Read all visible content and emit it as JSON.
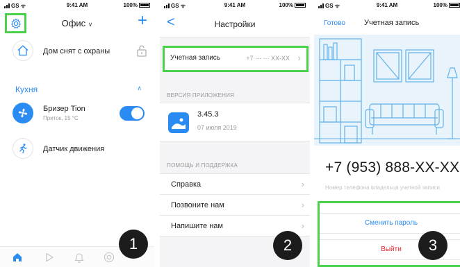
{
  "screen1": {
    "status": {
      "carrier": "GS",
      "time": "9:41 AM",
      "battery": "100%"
    },
    "title": "Офис",
    "title_chevron": "∨",
    "add_label": "+",
    "home_row": {
      "label": "Дом снят с охраны"
    },
    "section": {
      "label": "Кухня",
      "chevron": "∧"
    },
    "breezer": {
      "label": "Бризер Tion",
      "sub": "Приток, 15 °C",
      "toggle_on": true
    },
    "motion": {
      "label": "Датчик движения"
    },
    "tabs": [
      "home-icon",
      "play-icon",
      "bell-icon",
      "settings-icon"
    ],
    "step": "1"
  },
  "screen2": {
    "status": {
      "carrier": "GS",
      "time": "9:41 AM",
      "battery": "100%"
    },
    "title": "Настройки",
    "back": "<",
    "account": {
      "label": "Учетная запись",
      "value": "+7 ··· ··· XX-XX"
    },
    "app_version_header": "ВЕРСИЯ ПРИЛОЖЕНИЯ",
    "app": {
      "version": "3.45.3",
      "date": "07 июля 2019"
    },
    "help_header": "ПОМОЩЬ И ПОДДЕРЖКА",
    "help_items": [
      {
        "label": "Справка"
      },
      {
        "label": "Позвоните нам"
      },
      {
        "label": "Напишите нам"
      }
    ],
    "step": "2"
  },
  "screen3": {
    "status": {
      "carrier": "GS",
      "time": "9:41 AM",
      "battery": "100%"
    },
    "done": "Готово",
    "title": "Учетная запись",
    "phone": "+7 (953) 888-XX-XX",
    "phone_hint": "Номер телефона владельца учетной записи",
    "change_password": "Сменить пароль",
    "logout": "Выйти",
    "step": "3"
  },
  "colors": {
    "accent": "#2a8cf3",
    "highlight": "#4cd14c",
    "danger": "#e8262b",
    "badge": "#1c1c1c"
  }
}
